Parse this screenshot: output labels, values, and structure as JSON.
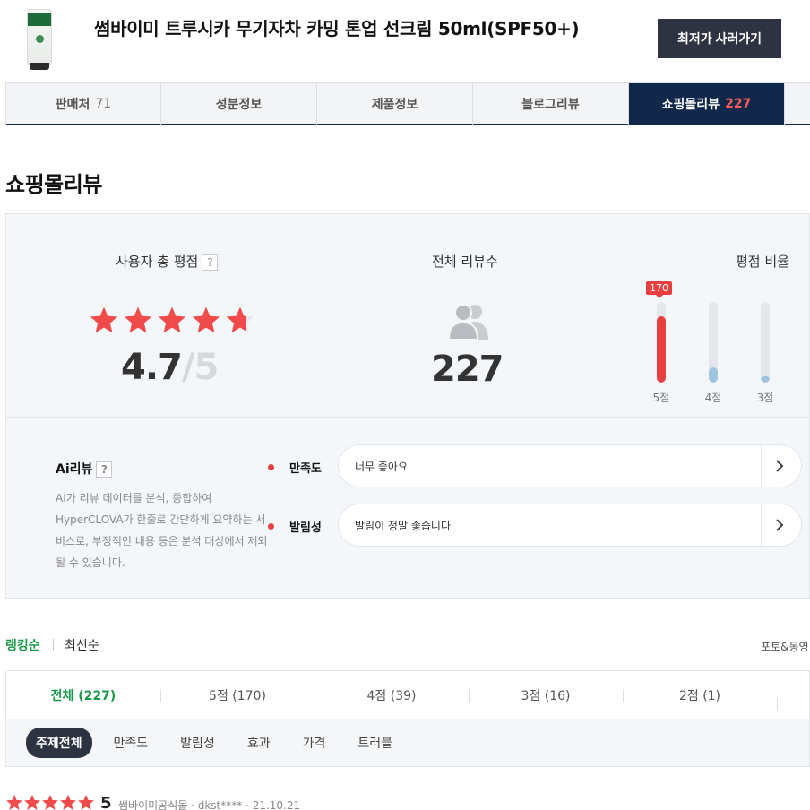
{
  "header": {
    "title": "썸바이미 트루시카 무기자차 카밍 톤업 선크림 50ml(SPF50+)",
    "buy_button": "최저가 사러가기",
    "thumb_icon": "sunscreen-tube-product-image"
  },
  "tabs": [
    {
      "label": "판매처",
      "count": "71"
    },
    {
      "label": "성분정보",
      "count": ""
    },
    {
      "label": "제품정보",
      "count": ""
    },
    {
      "label": "블로그리뷰",
      "count": ""
    },
    {
      "label": "쇼핑몰리뷰",
      "count": "227"
    }
  ],
  "section_title": "쇼핑몰리뷰",
  "summary": {
    "rating_label": "사용자 총 평점",
    "help_mark": "?",
    "rating": "4.7",
    "rating_max": "/5",
    "rating_value": 4.7,
    "review_count_label": "전체 리뷰수",
    "review_count": "227",
    "ratio_label": "평점 비율",
    "bars": [
      {
        "label": "5점",
        "value": 170,
        "badge": "170",
        "color": "#e9403f"
      },
      {
        "label": "4점",
        "value": 39,
        "color": "#9ec5e0"
      },
      {
        "label": "3점",
        "value": 16,
        "color": "#9ec5e0"
      }
    ]
  },
  "ai_review": {
    "title": "Ai리뷰",
    "help_mark": "?",
    "description": "AI가 리뷰 데이터를 분석, 종합하여 HyperCLOVA가 한줄로 간단하게 요약하는 서비스로, 부정적인 내용 등은 분석 대상에서 제외될 수 있습니다.",
    "items": [
      {
        "key": "만족도",
        "text": "너무 좋아요"
      },
      {
        "key": "발림성",
        "text": "발림이 정말 좋습니다"
      }
    ]
  },
  "sort": {
    "ranking": "랭킹순",
    "latest": "최신순",
    "photo_filter": "포토&동영"
  },
  "rating_filter": [
    {
      "label": "전체 (227)",
      "active": true
    },
    {
      "label": "5점 (170)"
    },
    {
      "label": "4점 (39)"
    },
    {
      "label": "3점 (16)"
    },
    {
      "label": "2점 (1)"
    }
  ],
  "topic_filter": [
    "주제전체",
    "만족도",
    "발림성",
    "효과",
    "가격",
    "트러블"
  ],
  "first_review": {
    "stars": 5,
    "score": "5",
    "meta": "썸바이미공식몰 · dkst**** · 21.10.21"
  },
  "colors": {
    "accent_red": "#e9403f",
    "nav_dark": "#11284a",
    "button_dark": "#2d3340",
    "green": "#1a9a4a"
  }
}
